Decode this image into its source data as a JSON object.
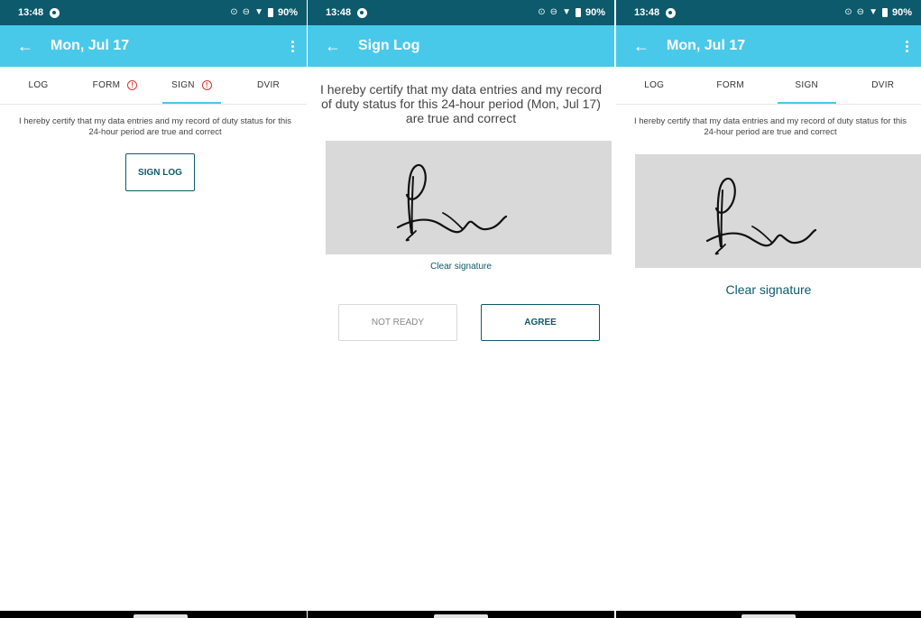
{
  "status": {
    "time": "13:48",
    "battery": "90%"
  },
  "screens": [
    {
      "title": "Mon, Jul 17",
      "tabs": [
        "LOG",
        "FORM",
        "SIGN",
        "DVIR"
      ],
      "active_tab": "SIGN",
      "warnings": [
        "FORM",
        "SIGN"
      ],
      "certification": "I hereby certify that my data entries and my record of duty status for this 24-hour period are true and correct",
      "sign_button": "SIGN LOG"
    },
    {
      "title": "Sign Log",
      "certification": "I hereby certify that my data entries and my record of duty status for this 24-hour period (Mon, Jul 17) are true and correct",
      "clear_signature": "Clear signature",
      "not_ready_button": "NOT READY",
      "agree_button": "AGREE"
    },
    {
      "title": "Mon, Jul 17",
      "tabs": [
        "LOG",
        "FORM",
        "SIGN",
        "DVIR"
      ],
      "active_tab": "SIGN",
      "certification": "I hereby certify that my data entries and my record of duty status for this 24-hour period are true and correct",
      "clear_signature": "Clear signature"
    }
  ],
  "colors": {
    "status_bar": "#0c5a6b",
    "app_bar": "#49c9ea",
    "accent": "#0c5a6b",
    "warning": "#dd3333",
    "signature_pad": "#d9d9d9"
  },
  "icons": [
    "back-arrow-icon",
    "more-vert-icon",
    "sync-icon",
    "wifi-icon",
    "battery-icon",
    "warning-icon"
  ]
}
